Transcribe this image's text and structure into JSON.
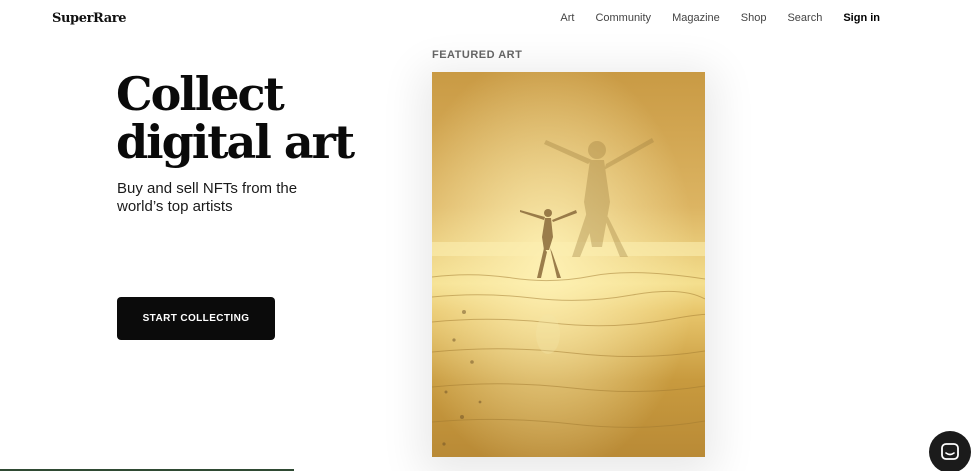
{
  "header": {
    "logo": "SuperRare",
    "nav": [
      "Art",
      "Community",
      "Magazine",
      "Shop",
      "Search"
    ],
    "sign_in": "Sign in"
  },
  "hero": {
    "headline": "Collect digital art",
    "subtitle": "Buy and sell NFTs from the world’s top artists",
    "cta": "START COLLECTING"
  },
  "featured": {
    "label": "FEATURED ART"
  },
  "colors": {
    "accent": "#0b0b0b",
    "art_gold": "#c99d3e"
  }
}
